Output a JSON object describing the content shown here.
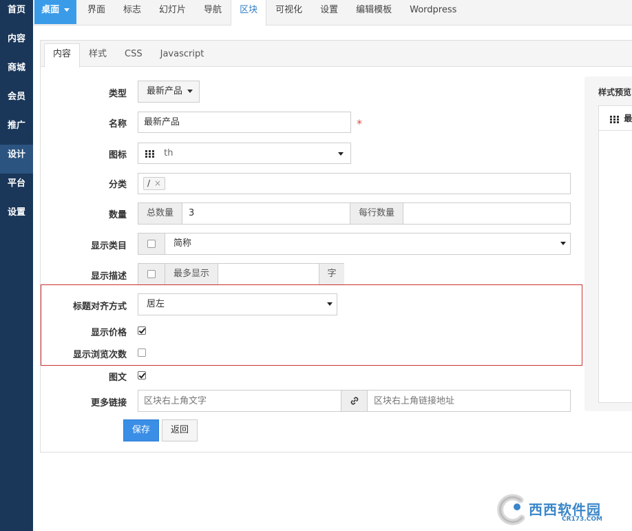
{
  "sidebar": {
    "items": [
      {
        "label": "首页"
      },
      {
        "label": "内容"
      },
      {
        "label": "商城"
      },
      {
        "label": "会员"
      },
      {
        "label": "推广"
      },
      {
        "label": "设计"
      },
      {
        "label": "平台"
      },
      {
        "label": "设置"
      }
    ],
    "active": "设计"
  },
  "topnav": {
    "desk_label": "桌面",
    "tabs": [
      {
        "label": "界面"
      },
      {
        "label": "标志"
      },
      {
        "label": "幻灯片"
      },
      {
        "label": "导航"
      },
      {
        "label": "区块"
      },
      {
        "label": "可视化"
      },
      {
        "label": "设置"
      },
      {
        "label": "编辑模板"
      },
      {
        "label": "Wordpress"
      }
    ],
    "active": "区块"
  },
  "subtabs": {
    "items": [
      {
        "label": "内容"
      },
      {
        "label": "样式"
      },
      {
        "label": "CSS"
      },
      {
        "label": "Javascript"
      }
    ],
    "active": "内容"
  },
  "form": {
    "type": {
      "label": "类型",
      "value": "最新产品"
    },
    "name": {
      "label": "名称",
      "value": "最新产品",
      "required_mark": "*"
    },
    "icon": {
      "label": "图标",
      "value": "th",
      "icon": "th-grid-icon"
    },
    "category": {
      "label": "分类",
      "tag": "/",
      "tag_remove": "×"
    },
    "count": {
      "label": "数量",
      "total_addon": "总数量",
      "total_value": "3",
      "per_row_addon": "每行数量",
      "per_row_value": ""
    },
    "show_category": {
      "label": "显示类目",
      "checked": false,
      "select_value": "简称"
    },
    "show_desc": {
      "label": "显示描述",
      "checked": false,
      "prefix": "最多显示",
      "value": "",
      "suffix": "字"
    },
    "title_align": {
      "label": "标题对齐方式",
      "value": "居左"
    },
    "show_price": {
      "label": "显示价格",
      "checked": true
    },
    "show_views": {
      "label": "显示浏览次数",
      "checked": false
    },
    "image_text": {
      "label": "图文",
      "checked": true
    },
    "more_link": {
      "label": "更多链接",
      "text_placeholder": "区块右上角文字",
      "url_placeholder": "区块右上角链接地址",
      "icon": "link-icon"
    }
  },
  "buttons": {
    "save": "保存",
    "back": "返回"
  },
  "preview": {
    "title": "样式预览",
    "head": "最新产品"
  },
  "watermark": {
    "text": "西西软件园",
    "sub": "CR173.COM"
  },
  "colors": {
    "sidebar_bg": "#1a3659",
    "accent": "#3a9ce9",
    "highlight_box": "#c9302c",
    "required": "#e04b3f"
  }
}
